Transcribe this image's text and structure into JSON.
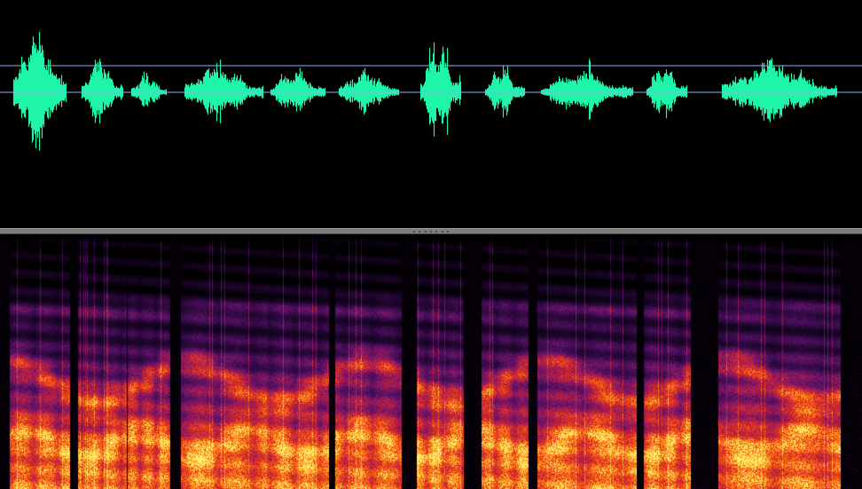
{
  "colors": {
    "background": "#000000",
    "waveform": "#1ef5a8",
    "reference_line": "#8fb0ff",
    "splitter": "#7d7d7d",
    "spectrogram_palette": [
      "#000000",
      "#2a0a3d",
      "#6a1466",
      "#b01e55",
      "#e8321e",
      "#ff6a10",
      "#ffb020",
      "#fff070"
    ]
  },
  "waveform": {
    "segments": [
      {
        "start": 0.015,
        "end": 0.077,
        "amplitude": 0.85
      },
      {
        "start": 0.094,
        "end": 0.143,
        "amplitude": 0.45
      },
      {
        "start": 0.152,
        "end": 0.193,
        "amplitude": 0.22
      },
      {
        "start": 0.213,
        "end": 0.305,
        "amplitude": 0.38
      },
      {
        "start": 0.313,
        "end": 0.377,
        "amplitude": 0.3
      },
      {
        "start": 0.392,
        "end": 0.462,
        "amplitude": 0.27
      },
      {
        "start": 0.487,
        "end": 0.534,
        "amplitude": 0.68
      },
      {
        "start": 0.562,
        "end": 0.609,
        "amplitude": 0.32
      },
      {
        "start": 0.627,
        "end": 0.734,
        "amplitude": 0.3
      },
      {
        "start": 0.75,
        "end": 0.797,
        "amplitude": 0.36
      },
      {
        "start": 0.837,
        "end": 0.971,
        "amplitude": 0.42
      }
    ]
  },
  "splitter": {
    "grip_dots": 7
  }
}
